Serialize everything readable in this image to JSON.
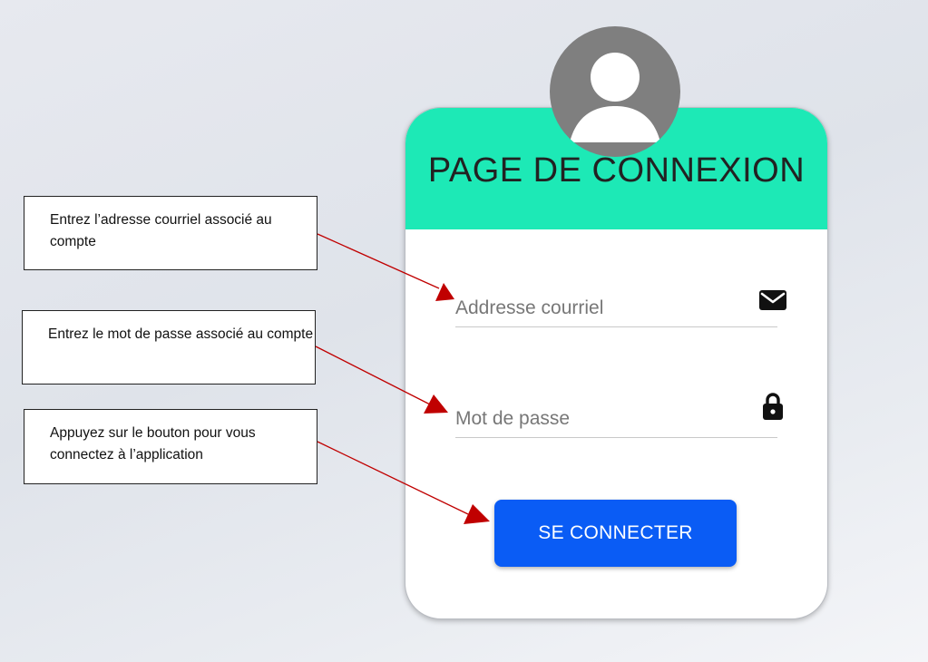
{
  "login_card": {
    "title": "PAGE DE CONNEXION",
    "email_placeholder": "Addresse courriel",
    "password_placeholder": "Mot de passe",
    "submit_label": "SE CONNECTER",
    "header_color": "#1de9b6",
    "button_color": "#0a5cf5"
  },
  "annotations": [
    {
      "text": "Entrez l’adresse courriel associé au compte"
    },
    {
      "text": "Entrez le mot de passe associé au compte"
    },
    {
      "text": "Appuyez sur le bouton pour vous connectez à l’application"
    }
  ],
  "icons": {
    "avatar": "user-avatar-icon",
    "email": "envelope-icon",
    "password": "lock-icon",
    "arrow_color": "#c00000"
  }
}
